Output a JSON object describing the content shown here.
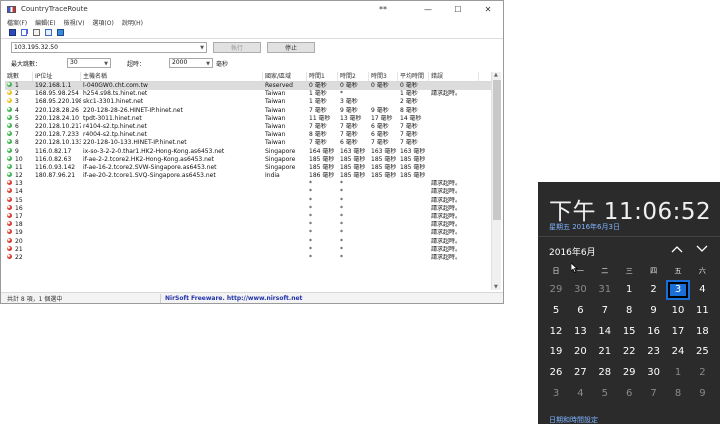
{
  "window": {
    "title": "CountryTraceRoute",
    "title_center": "**",
    "minimize": "—",
    "maximize": "☐",
    "close": "✕"
  },
  "menu": [
    "檔案(F)",
    "編輯(E)",
    "檢視(V)",
    "選項(O)",
    "說明(H)"
  ],
  "controls": {
    "address": "103.195.32.50",
    "run_label": "執行",
    "stop_label": "停止",
    "max_hops_label": "最大跳數：",
    "max_hops_value": "30",
    "timeout_label": "超時：",
    "timeout_value": "2000",
    "timeout_unit": "毫秒"
  },
  "columns": [
    "跳數",
    "IP位址",
    "主機名稱",
    "國家/區域",
    "時間1",
    "時間2",
    "時間3",
    "平均時間",
    "錯誤"
  ],
  "rows": [
    {
      "hop": "1",
      "color": "#39b54a",
      "ip": "192.168.1.1",
      "host": "l-040GW0.cht.com.tw",
      "country": "Reserved",
      "t1": "0 毫秒",
      "t2": "0 毫秒",
      "t3": "0 毫秒",
      "avg": "0 毫秒",
      "err": ""
    },
    {
      "hop": "2",
      "color": "#e8c31a",
      "ip": "168.95.98.254",
      "host": "h254.s98.ts.hinet.net",
      "country": "Taiwan",
      "t1": "1 毫秒",
      "t2": "*",
      "t3": "",
      "avg": "1 毫秒",
      "err": "請求超時。"
    },
    {
      "hop": "3",
      "color": "#e8c31a",
      "ip": "168.95.220.198",
      "host": "skc1-3301.hinet.net",
      "country": "Taiwan",
      "t1": "1 毫秒",
      "t2": "3 毫秒",
      "t3": "",
      "avg": "2 毫秒",
      "err": ""
    },
    {
      "hop": "4",
      "color": "#39b54a",
      "ip": "220.128.28.26",
      "host": "220-128-28-26.HINET-IP.hinet.net",
      "country": "Taiwan",
      "t1": "7 毫秒",
      "t2": "9 毫秒",
      "t3": "9 毫秒",
      "avg": "8 毫秒",
      "err": ""
    },
    {
      "hop": "5",
      "color": "#39b54a",
      "ip": "220.128.24.10",
      "host": "tpdt-3011.hinet.net",
      "country": "Taiwan",
      "t1": "11 毫秒",
      "t2": "13 毫秒",
      "t3": "17 毫秒",
      "avg": "14 毫秒",
      "err": ""
    },
    {
      "hop": "6",
      "color": "#39b54a",
      "ip": "220.128.10.217",
      "host": "r4104-s2.tp.hinet.net",
      "country": "Taiwan",
      "t1": "7 毫秒",
      "t2": "7 毫秒",
      "t3": "6 毫秒",
      "avg": "7 毫秒",
      "err": ""
    },
    {
      "hop": "7",
      "color": "#39b54a",
      "ip": "220.128.7.233",
      "host": "r4004-s2.tp.hinet.net",
      "country": "Taiwan",
      "t1": "8 毫秒",
      "t2": "7 毫秒",
      "t3": "6 毫秒",
      "avg": "7 毫秒",
      "err": ""
    },
    {
      "hop": "8",
      "color": "#39b54a",
      "ip": "220.128.10.133",
      "host": "220-128-10-133.HINET-IP.hinet.net",
      "country": "Taiwan",
      "t1": "7 毫秒",
      "t2": "6 毫秒",
      "t3": "7 毫秒",
      "avg": "7 毫秒",
      "err": ""
    },
    {
      "hop": "9",
      "color": "#39b54a",
      "ip": "116.0.82.17",
      "host": "ix-so-3-2-2-0.thar1.HK2-Hong-Kong.as6453.net",
      "country": "Singapore",
      "t1": "164 毫秒",
      "t2": "163 毫秒",
      "t3": "163 毫秒",
      "avg": "163 毫秒",
      "err": ""
    },
    {
      "hop": "10",
      "color": "#39b54a",
      "ip": "116.0.82.63",
      "host": "if-ae-2-2.tcore2.HK2-Hong-Kong.as6453.net",
      "country": "Singapore",
      "t1": "185 毫秒",
      "t2": "185 毫秒",
      "t3": "185 毫秒",
      "avg": "185 毫秒",
      "err": ""
    },
    {
      "hop": "11",
      "color": "#39b54a",
      "ip": "116.0.93.142",
      "host": "if-ae-16-2.tcore2.SVW-Singapore.as6453.net",
      "country": "Singapore",
      "t1": "185 毫秒",
      "t2": "185 毫秒",
      "t3": "185 毫秒",
      "avg": "185 毫秒",
      "err": ""
    },
    {
      "hop": "12",
      "color": "#39b54a",
      "ip": "180.87.96.21",
      "host": "if-ae-20-2.tcore1.SVQ-Singapore.as6453.net",
      "country": "India",
      "t1": "186 毫秒",
      "t2": "185 毫秒",
      "t3": "185 毫秒",
      "avg": "185 毫秒",
      "err": ""
    },
    {
      "hop": "13",
      "color": "#d93a2b",
      "ip": "",
      "host": "",
      "country": "",
      "t1": "*",
      "t2": "*",
      "t3": "",
      "avg": "",
      "err": "請求超時。"
    },
    {
      "hop": "14",
      "color": "#d93a2b",
      "ip": "",
      "host": "",
      "country": "",
      "t1": "*",
      "t2": "*",
      "t3": "",
      "avg": "",
      "err": "請求超時。"
    },
    {
      "hop": "15",
      "color": "#d93a2b",
      "ip": "",
      "host": "",
      "country": "",
      "t1": "*",
      "t2": "*",
      "t3": "",
      "avg": "",
      "err": "請求超時。"
    },
    {
      "hop": "16",
      "color": "#d93a2b",
      "ip": "",
      "host": "",
      "country": "",
      "t1": "*",
      "t2": "*",
      "t3": "",
      "avg": "",
      "err": "請求超時。"
    },
    {
      "hop": "17",
      "color": "#d93a2b",
      "ip": "",
      "host": "",
      "country": "",
      "t1": "*",
      "t2": "*",
      "t3": "",
      "avg": "",
      "err": "請求超時。"
    },
    {
      "hop": "18",
      "color": "#d93a2b",
      "ip": "",
      "host": "",
      "country": "",
      "t1": "*",
      "t2": "*",
      "t3": "",
      "avg": "",
      "err": "請求超時。"
    },
    {
      "hop": "19",
      "color": "#d93a2b",
      "ip": "",
      "host": "",
      "country": "",
      "t1": "*",
      "t2": "*",
      "t3": "",
      "avg": "",
      "err": "請求超時。"
    },
    {
      "hop": "20",
      "color": "#d93a2b",
      "ip": "",
      "host": "",
      "country": "",
      "t1": "*",
      "t2": "*",
      "t3": "",
      "avg": "",
      "err": "請求超時。"
    },
    {
      "hop": "21",
      "color": "#d93a2b",
      "ip": "",
      "host": "",
      "country": "",
      "t1": "*",
      "t2": "*",
      "t3": "",
      "avg": "",
      "err": "請求超時。"
    },
    {
      "hop": "22",
      "color": "#d93a2b",
      "ip": "",
      "host": "",
      "country": "",
      "t1": "*",
      "t2": "*",
      "t3": "",
      "avg": "",
      "err": "請求超時。"
    }
  ],
  "status": {
    "left": "共計 8 項，1 個選中",
    "right": "NirSoft Freeware.  http://www.nirsoft.net"
  },
  "calendar": {
    "time": "下午 11:06:52",
    "date": "星期五 2016年6月3日",
    "month": "2016年6月",
    "weekdays": [
      "日",
      "一",
      "二",
      "三",
      "四",
      "五",
      "六"
    ],
    "days": [
      {
        "n": "29",
        "out": true
      },
      {
        "n": "30",
        "out": true
      },
      {
        "n": "31",
        "out": true
      },
      {
        "n": "1",
        "out": false
      },
      {
        "n": "2",
        "out": false
      },
      {
        "n": "3",
        "out": false,
        "today": true
      },
      {
        "n": "4",
        "out": false
      },
      {
        "n": "5",
        "out": false
      },
      {
        "n": "6",
        "out": false
      },
      {
        "n": "7",
        "out": false
      },
      {
        "n": "8",
        "out": false
      },
      {
        "n": "9",
        "out": false
      },
      {
        "n": "10",
        "out": false
      },
      {
        "n": "11",
        "out": false
      },
      {
        "n": "12",
        "out": false
      },
      {
        "n": "13",
        "out": false
      },
      {
        "n": "14",
        "out": false
      },
      {
        "n": "15",
        "out": false
      },
      {
        "n": "16",
        "out": false
      },
      {
        "n": "17",
        "out": false
      },
      {
        "n": "18",
        "out": false
      },
      {
        "n": "19",
        "out": false
      },
      {
        "n": "20",
        "out": false
      },
      {
        "n": "21",
        "out": false
      },
      {
        "n": "22",
        "out": false
      },
      {
        "n": "23",
        "out": false
      },
      {
        "n": "24",
        "out": false
      },
      {
        "n": "25",
        "out": false
      },
      {
        "n": "26",
        "out": false
      },
      {
        "n": "27",
        "out": false
      },
      {
        "n": "28",
        "out": false
      },
      {
        "n": "29",
        "out": false
      },
      {
        "n": "30",
        "out": false
      },
      {
        "n": "1",
        "out": true
      },
      {
        "n": "2",
        "out": true
      },
      {
        "n": "3",
        "out": true
      },
      {
        "n": "4",
        "out": true
      },
      {
        "n": "5",
        "out": true
      },
      {
        "n": "6",
        "out": true
      },
      {
        "n": "7",
        "out": true
      },
      {
        "n": "8",
        "out": true
      },
      {
        "n": "9",
        "out": true
      }
    ],
    "link": "日期和時間設定",
    "accent": "#1a6ed8"
  }
}
